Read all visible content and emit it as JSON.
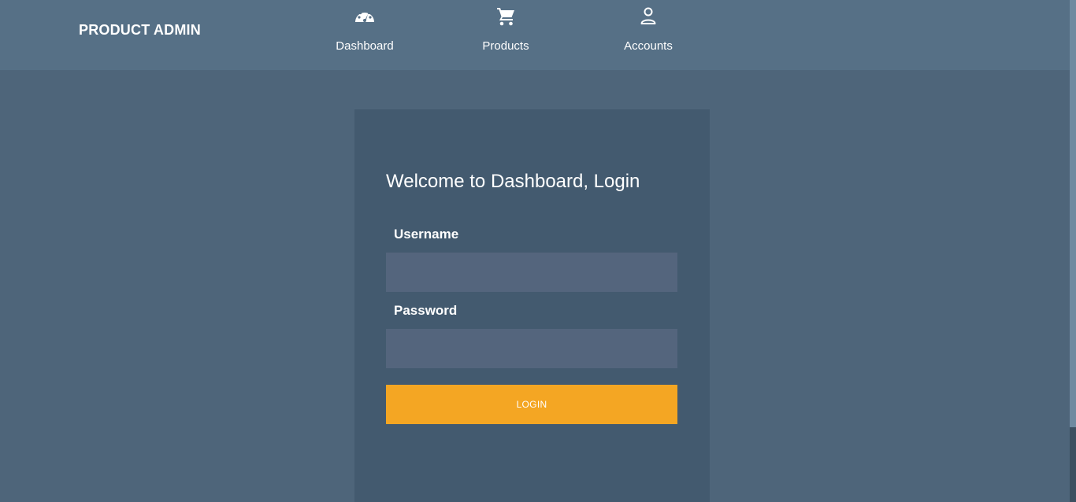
{
  "header": {
    "brand": "PRODUCT ADMIN",
    "nav": [
      {
        "label": "Dashboard",
        "icon": "speedometer-icon"
      },
      {
        "label": "Products",
        "icon": "shopping-cart-icon"
      },
      {
        "label": "Accounts",
        "icon": "user-icon"
      }
    ]
  },
  "login": {
    "title": "Welcome to Dashboard, Login",
    "username_label": "Username",
    "username_value": "",
    "password_label": "Password",
    "password_value": "",
    "button_label": "LOGIN"
  },
  "colors": {
    "page_bg": "#4e657a",
    "header_bg": "#567086",
    "card_bg": "#435a6f",
    "input_bg": "#54657d",
    "accent": "#f4a623"
  }
}
